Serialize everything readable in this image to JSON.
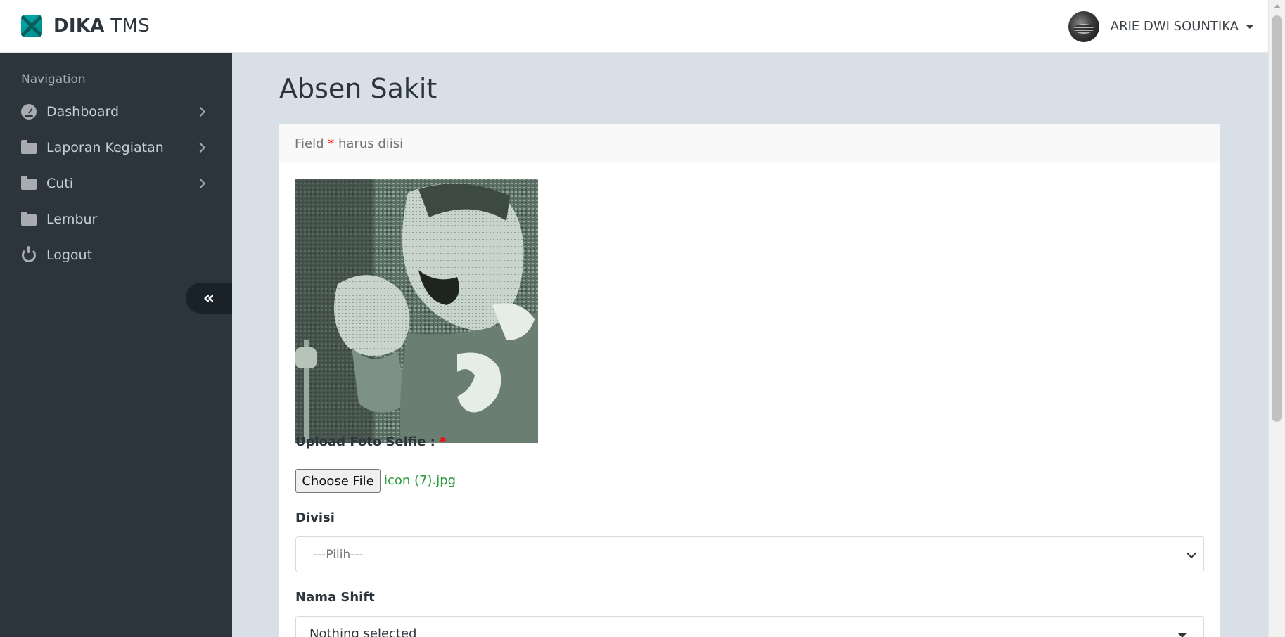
{
  "header": {
    "brand_bold": "DIKA",
    "brand_light": "TMS",
    "user_name": "ARIE DWI SOUNTIKA"
  },
  "sidebar": {
    "nav_header": "Navigation",
    "items": [
      {
        "label": "Dashboard",
        "icon": "dashboard-gauge-icon",
        "has_submenu": true
      },
      {
        "label": "Laporan Kegiatan",
        "icon": "folder-icon",
        "has_submenu": true
      },
      {
        "label": "Cuti",
        "icon": "folder-icon",
        "has_submenu": true
      },
      {
        "label": "Lembur",
        "icon": "folder-icon",
        "has_submenu": false
      },
      {
        "label": "Logout",
        "icon": "power-icon",
        "has_submenu": false
      }
    ],
    "collapse_glyph": "«"
  },
  "main": {
    "page_title": "Absen Sakit",
    "panel_heading_pre": "Field",
    "required_marker": "*",
    "panel_heading_post": "harus diisi",
    "form": {
      "upload_label": "Upload Foto Selfie :",
      "choose_file_label": "Choose File",
      "selected_file": "icon (7).jpg",
      "divisi_label": "Divisi",
      "divisi_value": "---Pilih---",
      "shift_label": "Nama Shift",
      "shift_value": "Nothing selected"
    }
  },
  "colors": {
    "sidebar_bg": "#2d353c",
    "content_bg": "#d9dfe7",
    "brand_accent": "#00acac",
    "required": "#ff0000",
    "file_name": "#2a9a3a"
  }
}
